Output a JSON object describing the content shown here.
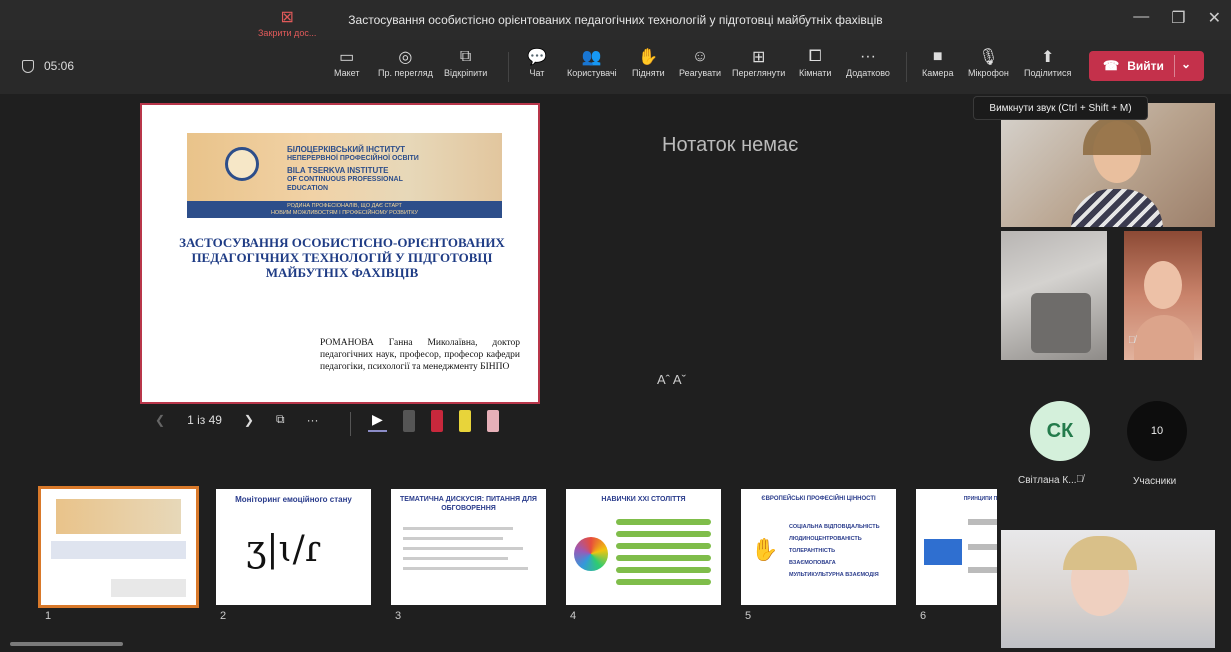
{
  "window": {
    "title": "Застосування особистісно орієнтованих педагогічних технологій у підготовці майбутніх фахівців",
    "controls": [
      "—",
      "❐",
      "✕"
    ]
  },
  "toolbar": {
    "timer": "05:06",
    "buttons": [
      {
        "label": "Закрити дос...",
        "icon": "close-share-icon",
        "glyph": "⊠"
      },
      {
        "label": "Макет",
        "icon": "layout-icon",
        "glyph": "▭"
      },
      {
        "label": "Пр. перегляд",
        "icon": "eye-icon",
        "glyph": "◎"
      },
      {
        "label": "Відкріпити",
        "icon": "popout-icon",
        "glyph": "⧉"
      },
      {
        "label": "Чат",
        "icon": "chat-icon",
        "glyph": "💬"
      },
      {
        "label": "Користувачі",
        "icon": "people-icon",
        "glyph": "👥"
      },
      {
        "label": "Підняти",
        "icon": "raise-hand-icon",
        "glyph": "✋"
      },
      {
        "label": "Реагувати",
        "icon": "react-icon",
        "glyph": "☺"
      },
      {
        "label": "Переглянути",
        "icon": "view-icon",
        "glyph": "⊞"
      },
      {
        "label": "Кімнати",
        "icon": "rooms-icon",
        "glyph": "⧠"
      },
      {
        "label": "Додатково",
        "icon": "more-icon",
        "glyph": "···"
      },
      {
        "label": "Камера",
        "icon": "camera-icon",
        "glyph": "■"
      },
      {
        "label": "Мікрофон",
        "icon": "mic-icon",
        "glyph": "🎙"
      },
      {
        "label": "Поділитися",
        "icon": "share-icon",
        "glyph": "⬆"
      }
    ],
    "exit_label": "Вийти"
  },
  "tooltip": "Вимкнути звук (Ctrl + Shift + M)",
  "slide": {
    "institute_ua_1": "БІЛОЦЕРКІВСЬКИЙ ІНСТИТУТ",
    "institute_ua_2": "НЕПЕРЕРВНОЇ ПРОФЕСІЙНОЇ ОСВІТИ",
    "institute_en_1": "BILA TSERKVA INSTITUTE",
    "institute_en_2": "OF CONTINUOUS PROFESSIONAL",
    "institute_en_3": "EDUCATION",
    "strip_1": "РОДИНА ПРОФЕСІОНАЛІВ, ЩО ДАЄ СТАРТ",
    "strip_2": "НОВИМ МОЖЛИВОСТЯМ І ПРОФЕСІЙНОМУ РОЗВИТКУ",
    "heading": "ЗАСТОСУВАННЯ ОСОБИСТІСНО-ОРІЄНТОВАНИХ ПЕДАГОГІЧНИХ ТЕХНОЛОГІЙ У ПІДГОТОВЦІ МАЙБУТНІХ ФАХІВЦІВ",
    "author": "РОМАНОВА Ганна Миколаївна, доктор педагогічних наук, професор, професор кафедри педагогіки, психології та менеджменту БІНПО"
  },
  "notes": "Нотаток немає",
  "font_controls": "Aˆ Aˇ",
  "slide_nav": {
    "position": "1 із 49"
  },
  "thumbnails": [
    {
      "num": "1",
      "title": ""
    },
    {
      "num": "2",
      "title": "Моніторинг емоційного стану"
    },
    {
      "num": "3",
      "title": "ТЕМАТИЧНА ДИСКУСІЯ: ПИТАННЯ ДЛЯ ОБГОВОРЕННЯ"
    },
    {
      "num": "4",
      "title": "НАВИЧКИ XXI СТОЛІТТЯ"
    },
    {
      "num": "5",
      "title": "ЄВРОПЕЙСЬКІ ПРОФЕСІЙНІ ЦІННОСТІ"
    },
    {
      "num": "6",
      "title": "ПРИНЦИПИ ПОВЕДІНКИ"
    }
  ],
  "thumb5_items": [
    "СОЦІАЛЬНА ВІДПОВІДАЛЬНІСТЬ",
    "ЛЮДИНОЦЕНТРОВАНІСТЬ",
    "ТОЛЕРАНТНІСТЬ",
    "ВЗАЄМОПОВАГА",
    "МУЛЬТИКУЛЬТУРНА ВЗАЄМОДІЯ"
  ],
  "participants": {
    "avatar_initials": "СК",
    "avatar_name": "Світлана К...",
    "count": "10",
    "count_label": "Учасники"
  }
}
